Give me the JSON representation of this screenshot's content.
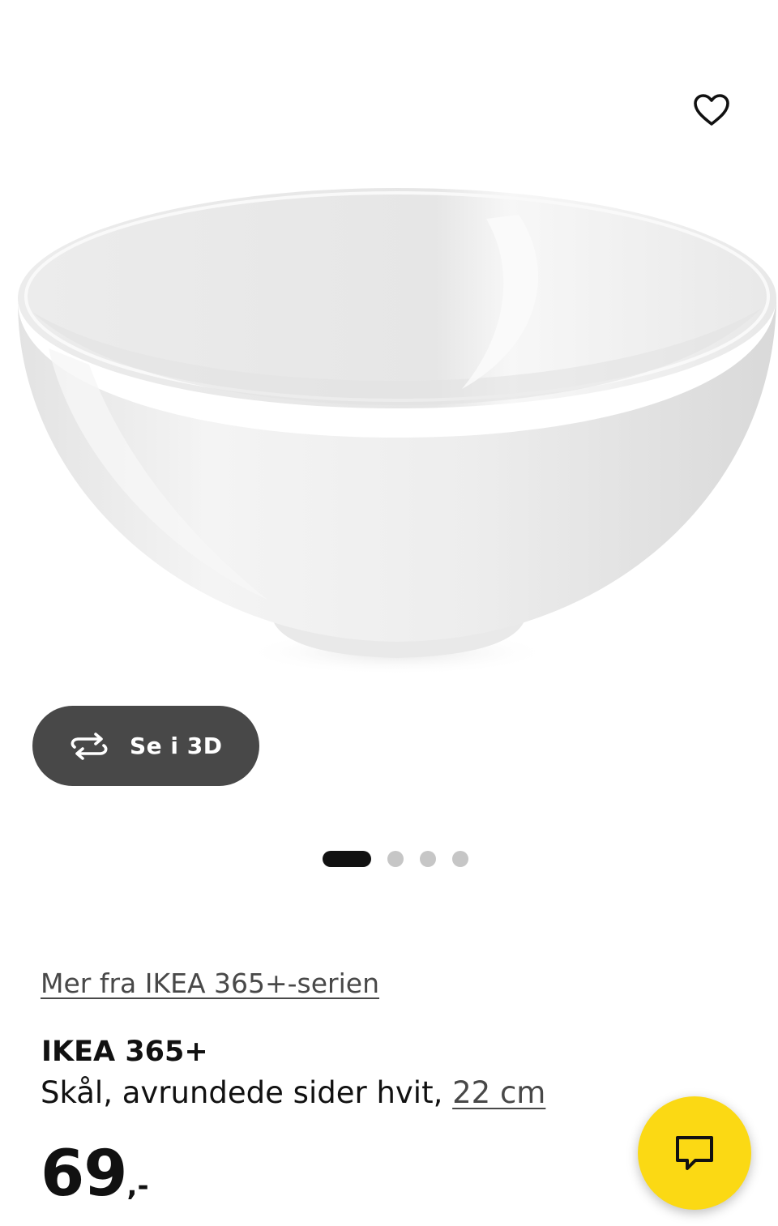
{
  "product_image": {
    "alt": "IKEA 365+ Skål, avrundede sider hvit"
  },
  "favorite": {
    "icon": "heart-outline-icon"
  },
  "view_3d": {
    "icon": "rotate-3d-icon",
    "label": "Se i 3D"
  },
  "carousel": {
    "total_slides": 4,
    "active_index": 0
  },
  "series_link": {
    "label": "Mer fra IKEA 365+-serien"
  },
  "product": {
    "name": "IKEA 365+",
    "description_prefix": "Skål, avrundede sider hvit, ",
    "size": "22 cm"
  },
  "price": {
    "integer": "69",
    "suffix": ",-"
  },
  "chat": {
    "icon": "chat-bubble-icon"
  },
  "colors": {
    "accent_yellow": "#fbd914",
    "button_dark": "#484848",
    "text_primary": "#111111",
    "dot_inactive": "#c6c6c6"
  }
}
